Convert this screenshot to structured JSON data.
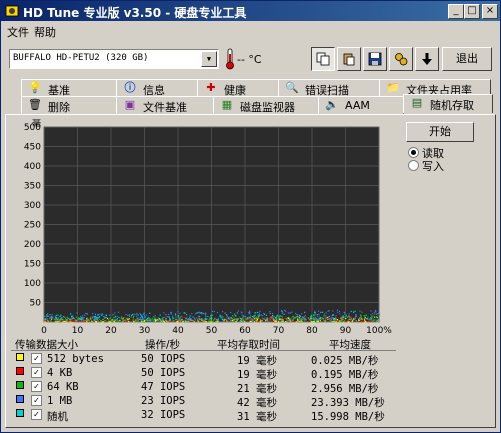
{
  "window": {
    "title": "HD Tune 专业版 v3.50 - 硬盘专业工具",
    "controls": {
      "minimize": "_",
      "maximize": "□",
      "close": "×"
    }
  },
  "menu": [
    {
      "label": "文件"
    },
    {
      "label": "帮助"
    }
  ],
  "toolbar": {
    "drive": "BUFFALO HD-PETU2 (320 GB)",
    "temperature": "-- °C",
    "exit_label": "退出"
  },
  "tabs_top": [
    {
      "label": "基准",
      "icon": "lightbulb-icon"
    },
    {
      "label": "信息",
      "icon": "info-icon"
    },
    {
      "label": "健康",
      "icon": "health-cross-icon"
    },
    {
      "label": "错误扫描",
      "icon": "magnifier-icon"
    },
    {
      "label": "文件夹占用率",
      "icon": "folder-icon"
    }
  ],
  "tabs_bottom": [
    {
      "label": "删除",
      "icon": "trash-icon"
    },
    {
      "label": "文件基准",
      "icon": "file-bench-icon"
    },
    {
      "label": "磁盘监视器",
      "icon": "monitor-icon"
    },
    {
      "label": "AAM",
      "icon": "speaker-icon"
    },
    {
      "label": "随机存取",
      "icon": "random-access-icon",
      "active": true
    }
  ],
  "controls": {
    "start_label": "开始",
    "read_label": "读取",
    "write_label": "写入",
    "selected": "read"
  },
  "chart_data": {
    "type": "scatter",
    "ylabel": "毫秒",
    "yticks": [
      "500",
      "450",
      "400",
      "350",
      "300",
      "250",
      "200",
      "150",
      "100",
      "50"
    ],
    "xticks": [
      "0",
      "10",
      "20",
      "30",
      "40",
      "50",
      "60",
      "70",
      "80",
      "90",
      "100%"
    ],
    "ylim": [
      0,
      500
    ],
    "xlim": [
      0,
      100
    ],
    "series": [
      {
        "color": "#ffff00",
        "band": [
          2,
          12
        ]
      },
      {
        "color": "#ff0000",
        "band": [
          3,
          15
        ]
      },
      {
        "color": "#00c000",
        "band": [
          4,
          18
        ]
      },
      {
        "color": "#3a78ff",
        "band": [
          8,
          30
        ]
      },
      {
        "color": "#00d0d0",
        "band": [
          5,
          26
        ]
      }
    ],
    "grid": true
  },
  "table": {
    "headers": [
      "传输数据大小",
      "操作/秒",
      "平均存取时间",
      "平均速度"
    ],
    "rows": [
      {
        "color": "#ffff00",
        "checked": true,
        "size": "512 bytes",
        "ops": "50 IOPS",
        "time": "19 毫秒",
        "speed": "0.025 MB/秒"
      },
      {
        "color": "#ff0000",
        "checked": true,
        "size": "4 KB",
        "ops": "50 IOPS",
        "time": "19 毫秒",
        "speed": "0.195 MB/秒"
      },
      {
        "color": "#00c000",
        "checked": true,
        "size": "64 KB",
        "ops": "47 IOPS",
        "time": "21 毫秒",
        "speed": "2.956 MB/秒"
      },
      {
        "color": "#3a78ff",
        "checked": true,
        "size": "1 MB",
        "ops": "23 IOPS",
        "time": "42 毫秒",
        "speed": "23.393 MB/秒"
      },
      {
        "color": "#00d0d0",
        "checked": true,
        "size": "随机",
        "ops": "32 IOPS",
        "time": "31 毫秒",
        "speed": "15.998 MB/秒"
      }
    ]
  }
}
